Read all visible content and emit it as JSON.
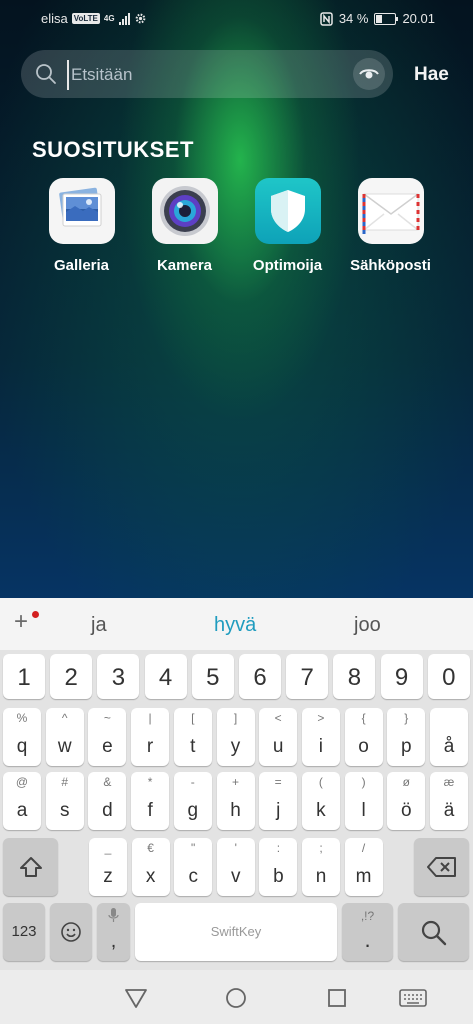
{
  "status_bar": {
    "carrier": "elisa",
    "volte": "VoLTE",
    "network": "4G",
    "battery_percent": "34 %",
    "battery_level": 0.34,
    "time": "20.01"
  },
  "search": {
    "placeholder": "Etsitään",
    "value": "",
    "submit_label": "Hae"
  },
  "suggestions_section": {
    "title": "SUOSITUKSET",
    "apps": [
      {
        "label": "Galleria",
        "icon": "gallery-icon"
      },
      {
        "label": "Kamera",
        "icon": "camera-icon"
      },
      {
        "label": "Optimoija",
        "icon": "shield-icon"
      },
      {
        "label": "Sähköposti",
        "icon": "mail-icon"
      }
    ]
  },
  "keyboard": {
    "word_suggestions": [
      "ja",
      "hyvä",
      "joo"
    ],
    "highlighted_suggestion": "hyvä",
    "number_row": [
      "1",
      "2",
      "3",
      "4",
      "5",
      "6",
      "7",
      "8",
      "9",
      "0"
    ],
    "row1": [
      {
        "key": "q",
        "alt": "%"
      },
      {
        "key": "w",
        "alt": "^"
      },
      {
        "key": "e",
        "alt": "~"
      },
      {
        "key": "r",
        "alt": "|"
      },
      {
        "key": "t",
        "alt": "["
      },
      {
        "key": "y",
        "alt": "]"
      },
      {
        "key": "u",
        "alt": "<"
      },
      {
        "key": "i",
        "alt": ">"
      },
      {
        "key": "o",
        "alt": "{"
      },
      {
        "key": "p",
        "alt": "}"
      },
      {
        "key": "å",
        "alt": ""
      }
    ],
    "row2": [
      {
        "key": "a",
        "alt": "@"
      },
      {
        "key": "s",
        "alt": "#"
      },
      {
        "key": "d",
        "alt": "&"
      },
      {
        "key": "f",
        "alt": "*"
      },
      {
        "key": "g",
        "alt": "-"
      },
      {
        "key": "h",
        "alt": "+"
      },
      {
        "key": "j",
        "alt": "="
      },
      {
        "key": "k",
        "alt": "("
      },
      {
        "key": "l",
        "alt": ")"
      },
      {
        "key": "ö",
        "alt": "ø"
      },
      {
        "key": "ä",
        "alt": "æ"
      }
    ],
    "row3": [
      {
        "key": "z",
        "alt": "_"
      },
      {
        "key": "x",
        "alt": "€"
      },
      {
        "key": "c",
        "alt": "\""
      },
      {
        "key": "v",
        "alt": "'"
      },
      {
        "key": "b",
        "alt": ":"
      },
      {
        "key": "n",
        "alt": ";"
      },
      {
        "key": "m",
        "alt": "/"
      }
    ],
    "symbols_key": "123",
    "comma_key": ",",
    "space_brand": "SwiftKey",
    "period_key": ".",
    "period_alt": ",!?"
  },
  "colors": {
    "accent": "#1f9cbf",
    "keyboard_bg": "#e3e3e3",
    "key_bg": "#ffffff"
  }
}
